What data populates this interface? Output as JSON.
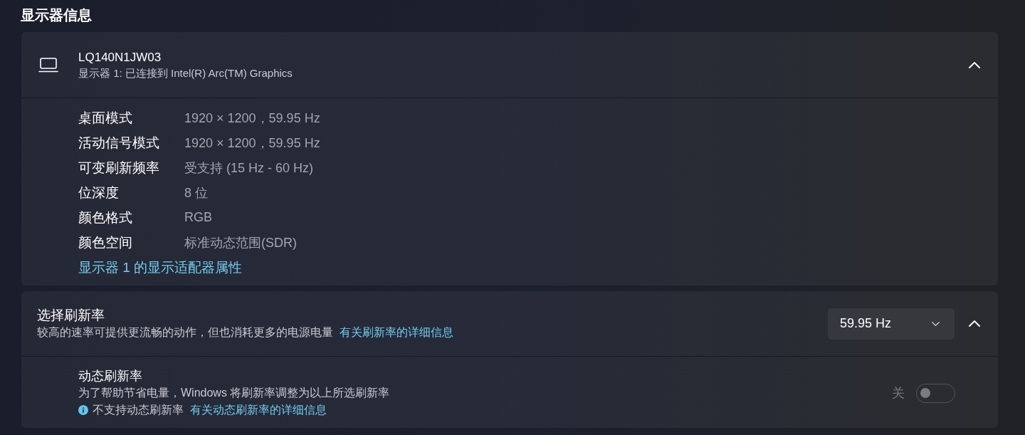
{
  "section_title": "显示器信息",
  "display_card": {
    "title": "LQ140N1JW03",
    "subtitle": "显示器 1: 已连接到 Intel(R) Arc(TM) Graphics",
    "expanded": true,
    "properties": [
      {
        "label": "桌面模式",
        "value": "1920 × 1200，59.95 Hz"
      },
      {
        "label": "活动信号模式",
        "value": "1920 × 1200，59.95 Hz"
      },
      {
        "label": "可变刷新频率",
        "value": "受支持 (15 Hz - 60 Hz)"
      },
      {
        "label": "位深度",
        "value": "8 位"
      },
      {
        "label": "颜色格式",
        "value": "RGB"
      },
      {
        "label": "颜色空间",
        "value": "标准动态范围(SDR)"
      }
    ],
    "link": "显示器 1 的显示适配器属性"
  },
  "refresh_rate_card": {
    "title": "选择刷新率",
    "description": "较高的速率可提供更流畅的动作，但也消耗更多的电源电量",
    "link": "有关刷新率的详细信息",
    "dropdown_value": "59.95 Hz",
    "expanded": true,
    "dynamic_refresh_rate": {
      "title": "动态刷新率",
      "description": "为了帮助节省电量，Windows 将刷新率调整为以上所选刷新率",
      "notice": "不支持动态刷新率",
      "link": "有关动态刷新率的详细信息",
      "toggle_label": "关",
      "on": false,
      "disabled": true
    }
  }
}
